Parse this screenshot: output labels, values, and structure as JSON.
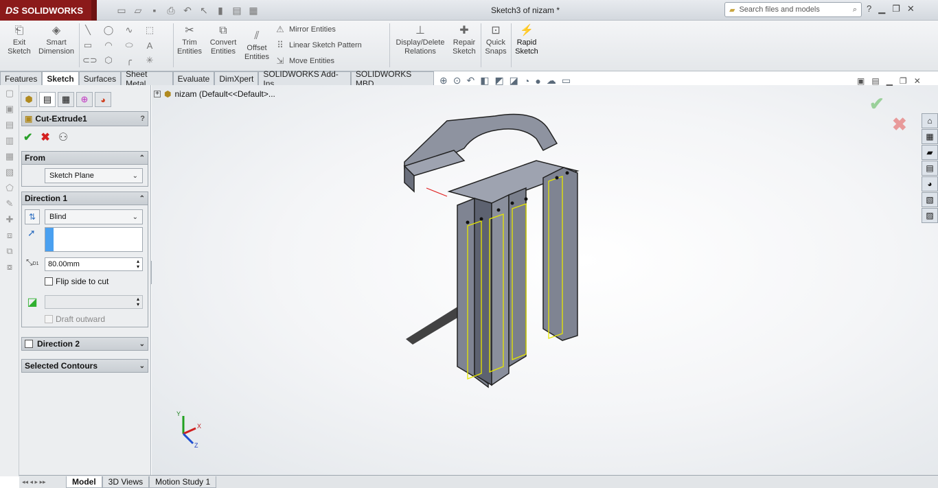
{
  "app": {
    "brand": "SOLIDWORKS",
    "title": "Sketch3 of nizam *"
  },
  "search": {
    "placeholder": "Search files and models"
  },
  "ribbon": {
    "exit_sketch": "Exit\nSketch",
    "smart_dimension": "Smart\nDimension",
    "trim_entities": "Trim\nEntities",
    "convert_entities": "Convert\nEntities",
    "offset_entities": "Offset\nEntities",
    "mirror_entities": "Mirror Entities",
    "linear_sketch_pattern": "Linear Sketch Pattern",
    "move_entities": "Move Entities",
    "display_delete_relations": "Display/Delete\nRelations",
    "repair_sketch": "Repair\nSketch",
    "quick_snaps": "Quick\nSnaps",
    "rapid_sketch": "Rapid\nSketch"
  },
  "tabs": [
    "Features",
    "Sketch",
    "Surfaces",
    "Sheet Metal",
    "Evaluate",
    "DimXpert",
    "SOLIDWORKS Add-Ins",
    "SOLIDWORKS MBD"
  ],
  "active_tab": "Sketch",
  "property_manager": {
    "feature_name": "Cut-Extrude1",
    "from": {
      "header": "From",
      "value": "Sketch Plane"
    },
    "direction1": {
      "header": "Direction 1",
      "end_condition": "Blind",
      "depth": "80.00mm",
      "flip_label": "Flip side to cut",
      "draft_label": "Draft outward",
      "depth_icon_label": "D1"
    },
    "direction2": {
      "header": "Direction 2"
    },
    "selected_contours": {
      "header": "Selected Contours"
    }
  },
  "tree": {
    "root": "nizam  (Default<<Default>..."
  },
  "bottom_tabs": [
    "Model",
    "3D Views",
    "Motion Study 1"
  ],
  "triad": {
    "x": "X",
    "y": "Y",
    "z": "Z"
  },
  "colors": {
    "brand": "#8b1a1a",
    "accept": "#2aa02a",
    "cancel": "#d42020",
    "part": "#7d8290",
    "sketch": "#e8e800"
  }
}
